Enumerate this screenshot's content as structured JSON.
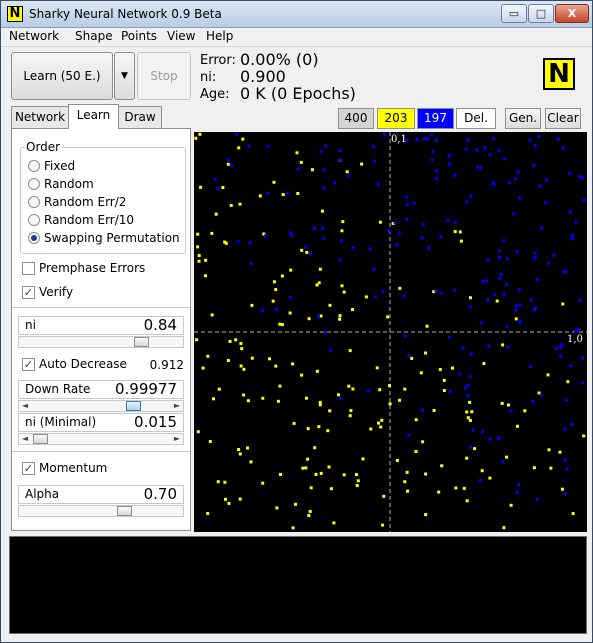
{
  "window": {
    "title": "Sharky Neural Network 0.9 Beta",
    "icon_letter": "N",
    "min_glyph": "▭",
    "max_glyph": "□",
    "close_glyph": "X"
  },
  "menu": [
    "Network",
    "Shape",
    "Points",
    "View",
    "Help"
  ],
  "toolbar": {
    "learn_label": "Learn (50 E.)",
    "dropdown_glyph": "▼",
    "stop_label": "Stop",
    "error_label": "Error:",
    "error_value": "0.00% (0)",
    "ni_label": "ni:",
    "ni_value": "0.900",
    "age_label": "Age:",
    "age_value": "0 K (0 Epochs)",
    "logo_letter": "N"
  },
  "tabs": [
    "Network",
    "Learn",
    "Draw"
  ],
  "active_tab": "Learn",
  "order": {
    "title": "Order",
    "options": [
      "Fixed",
      "Random",
      "Random Err/2",
      "Random Err/10",
      "Swapping Permutation"
    ],
    "selected": "Swapping Permutation"
  },
  "checks": {
    "premphase": {
      "label": "Premphase Errors",
      "checked": false
    },
    "verify": {
      "label": "Verify",
      "checked": true
    },
    "auto_decrease": {
      "label": "Auto Decrease",
      "checked": true,
      "value": "0.912"
    },
    "momentum": {
      "label": "Momentum",
      "checked": true
    }
  },
  "sliders": {
    "ni": {
      "label": "ni",
      "value": "0.84"
    },
    "down_rate": {
      "label": "Down Rate",
      "value": "0.99977"
    },
    "ni_minimal": {
      "label": "ni (Minimal)",
      "value": "0.015"
    },
    "alpha": {
      "label": "Alpha",
      "value": "0.70"
    }
  },
  "points": {
    "count_label": "400",
    "yellow_count": "203",
    "blue_count": "197",
    "delete_label": "Del.",
    "generate_label": "Gen.",
    "clear_label": "Clear",
    "yellow_color": "#ffff00",
    "blue_color": "#0000ff"
  },
  "plot": {
    "top_label": "0,1",
    "right_label": "1,0",
    "background": "#000000",
    "axis_color": "#b0b0b0"
  }
}
